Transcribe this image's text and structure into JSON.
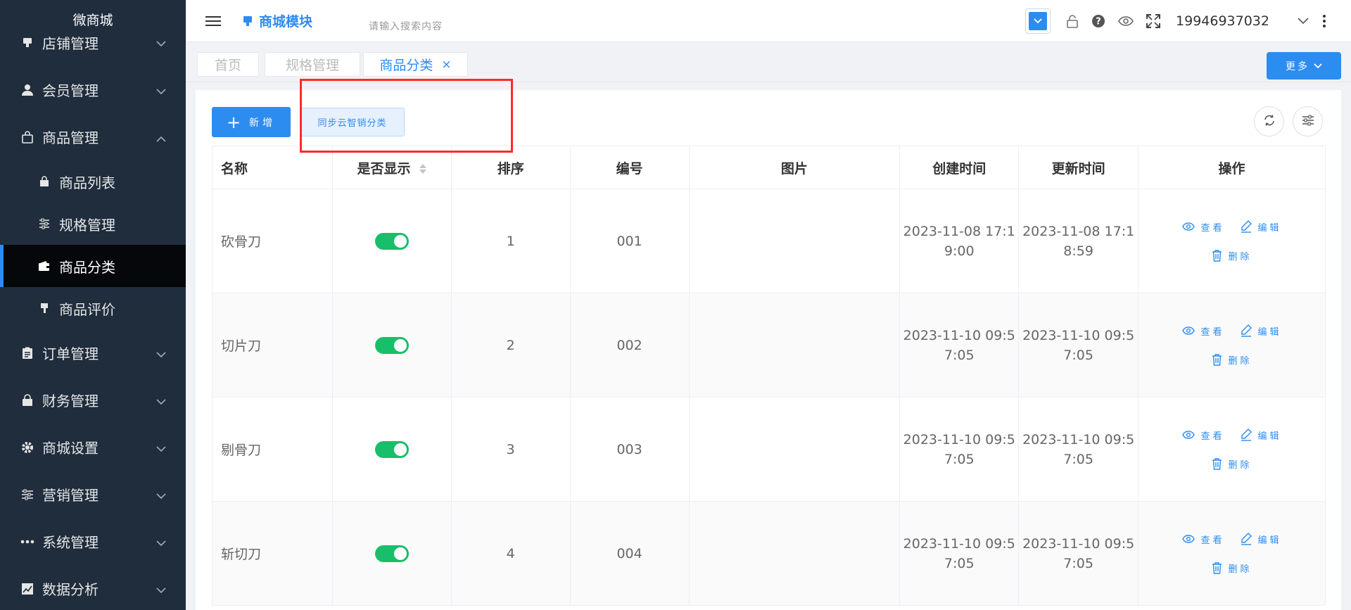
{
  "sidebar": {
    "title": "微商城",
    "items": [
      {
        "label": "店铺管理",
        "icon": "shop-icon"
      },
      {
        "label": "会员管理",
        "icon": "user-icon"
      },
      {
        "label": "商品管理",
        "icon": "bag-icon"
      },
      {
        "label": "订单管理",
        "icon": "clipboard-icon"
      },
      {
        "label": "财务管理",
        "icon": "lock-bag-icon"
      },
      {
        "label": "商城设置",
        "icon": "gear-icon"
      },
      {
        "label": "营销管理",
        "icon": "sliders-icon"
      },
      {
        "label": "系统管理",
        "icon": "dots-icon"
      },
      {
        "label": "数据分析",
        "icon": "chart-icon"
      }
    ],
    "subitems": [
      {
        "label": "商品列表",
        "icon": "bag-icon"
      },
      {
        "label": "规格管理",
        "icon": "sliders-icon"
      },
      {
        "label": "商品分类",
        "icon": "wallet-icon",
        "active": true
      },
      {
        "label": "商品评价",
        "icon": "brush-icon"
      }
    ]
  },
  "header": {
    "module": "商城模块",
    "search_placeholder": "请输入搜索内容",
    "phone": "19946937032"
  },
  "tabs": [
    {
      "label": "首页"
    },
    {
      "label": "规格管理"
    },
    {
      "label": "商品分类",
      "active": true,
      "close": "×"
    }
  ],
  "more_label": "更多",
  "toolbar": {
    "add_label": "新增",
    "add_plus": "+",
    "sync_label": "同步云智销分类"
  },
  "table": {
    "headers": [
      "名称",
      "是否显示",
      "排序",
      "编号",
      "图片",
      "创建时间",
      "更新时间",
      "操作"
    ],
    "rows": [
      {
        "name": "砍骨刀",
        "sort": "1",
        "code": "001",
        "created": "2023-11-08 17:1\n9:00",
        "updated": "2023-11-08 17:1\n8:59",
        "show": true
      },
      {
        "name": "切片刀",
        "sort": "2",
        "code": "002",
        "created": "2023-11-10 09:5\n7:05",
        "updated": "2023-11-10 09:5\n7:05",
        "show": true
      },
      {
        "name": "剔骨刀",
        "sort": "3",
        "code": "003",
        "created": "2023-11-10 09:5\n7:05",
        "updated": "2023-11-10 09:5\n7:05",
        "show": true
      },
      {
        "name": "斩切刀",
        "sort": "4",
        "code": "004",
        "created": "2023-11-10 09:5\n7:05",
        "updated": "2023-11-10 09:5\n7:05",
        "show": true
      }
    ],
    "actions": {
      "view": "查看",
      "edit": "编辑",
      "delete": "删除"
    }
  },
  "colors": {
    "accent": "#2d8cf0",
    "sidebar_bg": "#1f2d3d",
    "switch_on": "#19be6b",
    "highlight": "#ff2a2a"
  }
}
